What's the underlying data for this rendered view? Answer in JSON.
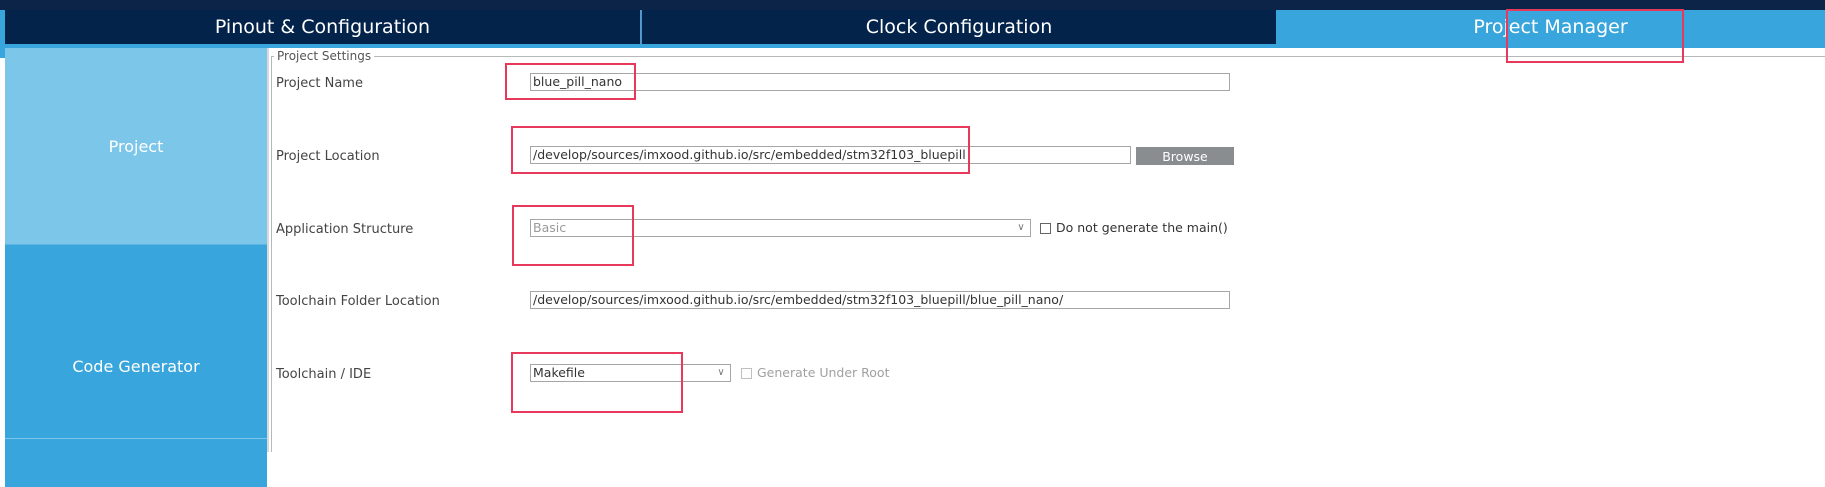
{
  "tabs": [
    {
      "label": "Pinout & Configuration",
      "active": false
    },
    {
      "label": "Clock Configuration",
      "active": false
    },
    {
      "label": "Project Manager",
      "active": true
    }
  ],
  "sidebar": {
    "items": [
      {
        "label": "Project",
        "active": true
      },
      {
        "label": "Code Generator",
        "active": false
      }
    ]
  },
  "project_settings": {
    "group_title": "Project Settings",
    "project_name": {
      "label": "Project Name",
      "value": "blue_pill_nano"
    },
    "project_location": {
      "label": "Project Location",
      "value": "/develop/sources/imxood.github.io/src/embedded/stm32f103_bluepill",
      "browse_label": "Browse"
    },
    "application_structure": {
      "label": "Application Structure",
      "value": "Basic",
      "checkbox_label": "Do not generate the main()",
      "checked": false
    },
    "toolchain_folder": {
      "label": "Toolchain Folder Location",
      "value": "/develop/sources/imxood.github.io/src/embedded/stm32f103_bluepill/blue_pill_nano/"
    },
    "toolchain_ide": {
      "label": "Toolchain / IDE",
      "value": "Makefile",
      "checkbox_label": "Generate Under Root",
      "checked": false
    }
  },
  "colors": {
    "nav_dark": "#03234b",
    "accent_blue": "#39a5dd",
    "sidebar_active": "#7cc6ea",
    "highlight": "#e8395c"
  },
  "icons": {
    "select_arrow": "chevron-down-icon",
    "checkbox": "checkbox-icon"
  }
}
